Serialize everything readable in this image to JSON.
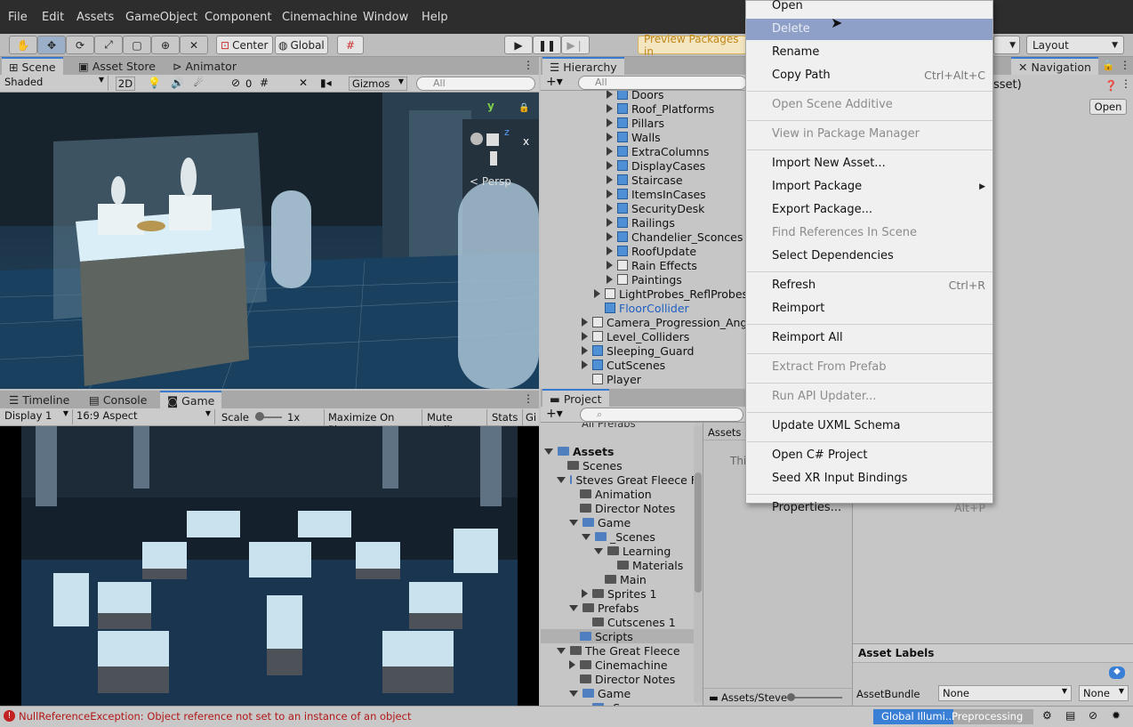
{
  "menubar": [
    "File",
    "Edit",
    "Assets",
    "GameObject",
    "Component",
    "Cinemachine",
    "Window",
    "Help"
  ],
  "toolbar": {
    "center": "Center",
    "global": "Global",
    "preview_packages": "Preview Packages in",
    "layout": "Layout"
  },
  "scene": {
    "tabs": [
      "Scene",
      "Asset Store",
      "Animator"
    ],
    "shaded": "Shaded",
    "mode_2d": "2D",
    "hidden_count": "0",
    "gizmos": "Gizmos",
    "search_placeholder": "All",
    "persp": "Persp",
    "axis_y": "y",
    "axis_x": "x",
    "axis_z": "z",
    "colors": {
      "sky": "#1f3444",
      "floor": "#1a3a57",
      "case": "#6f8ea1"
    }
  },
  "game": {
    "tabs": [
      "Timeline",
      "Console",
      "Game"
    ],
    "display": "Display 1",
    "aspect": "16:9 Aspect",
    "scale_label": "Scale",
    "scale_value": "1x",
    "maximize": "Maximize On Play",
    "mute": "Mute Audio",
    "stats": "Stats",
    "gizmos_short": "Gi"
  },
  "hierarchy": {
    "tab": "Hierarchy",
    "search_placeholder": "All",
    "items": [
      {
        "label": "Doors",
        "icon": "prefab-icon",
        "depth": 3
      },
      {
        "label": "Roof_Platforms",
        "icon": "prefab-icon",
        "depth": 3
      },
      {
        "label": "Pillars",
        "icon": "prefab-icon",
        "depth": 3
      },
      {
        "label": "Walls",
        "icon": "prefab-icon",
        "depth": 3
      },
      {
        "label": "ExtraColumns",
        "icon": "prefab-icon",
        "depth": 3
      },
      {
        "label": "DisplayCases",
        "icon": "prefab-icon",
        "depth": 3
      },
      {
        "label": "Staircase",
        "icon": "prefab-icon",
        "depth": 3
      },
      {
        "label": "ItemsInCases",
        "icon": "prefab-icon",
        "depth": 3
      },
      {
        "label": "SecurityDesk",
        "icon": "prefab-icon",
        "depth": 3
      },
      {
        "label": "Railings",
        "icon": "prefab-icon",
        "depth": 3
      },
      {
        "label": "Chandelier_Sconces",
        "icon": "prefab-icon",
        "depth": 3
      },
      {
        "label": "RoofUpdate",
        "icon": "prefab-icon",
        "depth": 3
      },
      {
        "label": "Rain Effects",
        "icon": "gameobject-icon",
        "depth": 3
      },
      {
        "label": "Paintings",
        "icon": "gameobject-icon",
        "depth": 3
      },
      {
        "label": "LightProbes_ReflProbes_C",
        "icon": "gameobject-icon",
        "depth": 2
      },
      {
        "label": "FloorCollider",
        "icon": "prefab-icon",
        "depth": 2
      },
      {
        "label": "Camera_Progression_Angles",
        "icon": "gameobject-icon",
        "depth": 1
      },
      {
        "label": "Level_Colliders",
        "icon": "gameobject-icon",
        "depth": 1
      },
      {
        "label": "Sleeping_Guard",
        "icon": "prefab-icon",
        "depth": 1
      },
      {
        "label": "CutScenes",
        "icon": "prefab-icon",
        "depth": 1
      },
      {
        "label": "Player",
        "icon": "gameobject-icon",
        "depth": 1
      }
    ]
  },
  "project": {
    "tab": "Project",
    "all_prefabs": "All Prefabs",
    "breadcrumb": "Assets",
    "right_text": "Thi",
    "path": "Assets/Steve",
    "tree": [
      {
        "label": "Assets",
        "depth": 0,
        "bold": true,
        "open": true
      },
      {
        "label": "Scenes",
        "depth": 1
      },
      {
        "label": "Steves Great Fleece F",
        "depth": 1,
        "open": true
      },
      {
        "label": "Animation",
        "depth": 2
      },
      {
        "label": "Director Notes",
        "depth": 2
      },
      {
        "label": "Game",
        "depth": 2,
        "open": true
      },
      {
        "label": "_Scenes",
        "depth": 3,
        "open": true
      },
      {
        "label": "Learning",
        "depth": 4,
        "open": true
      },
      {
        "label": "Materials",
        "depth": 5
      },
      {
        "label": "Main",
        "depth": 4
      },
      {
        "label": "Sprites 1",
        "depth": 3,
        "closed": true
      },
      {
        "label": "Prefabs",
        "depth": 2,
        "open": true
      },
      {
        "label": "Cutscenes 1",
        "depth": 3
      },
      {
        "label": "Scripts",
        "depth": 2,
        "selected": true
      },
      {
        "label": "The Great Fleece",
        "depth": 1,
        "open": true
      },
      {
        "label": "Cinemachine",
        "depth": 2,
        "closed": true
      },
      {
        "label": "Director Notes",
        "depth": 2
      },
      {
        "label": "Game",
        "depth": 2,
        "open": true
      },
      {
        "label": "_Scenes",
        "depth": 3
      }
    ]
  },
  "inspector": {
    "navigation_tab": "Navigation",
    "title_fragment": "sset)",
    "open_button": "Open",
    "asset_labels": "Asset Labels",
    "assetbundle_label": "AssetBundle",
    "assetbundle_value": "None",
    "variant_value": "None"
  },
  "context_menu": {
    "items": [
      {
        "label": "Open",
        "shortcut": "",
        "disabled": false
      },
      {
        "label": "Delete",
        "shortcut": "",
        "disabled": true,
        "hover": true
      },
      {
        "label": "Rename",
        "shortcut": "",
        "disabled": false
      },
      {
        "label": "Copy Path",
        "shortcut": "Ctrl+Alt+C",
        "disabled": false
      },
      {
        "sep": true
      },
      {
        "label": "Open Scene Additive",
        "shortcut": "",
        "disabled": true
      },
      {
        "sep": true
      },
      {
        "label": "View in Package Manager",
        "shortcut": "",
        "disabled": true
      },
      {
        "sep": true
      },
      {
        "label": "Import New Asset...",
        "shortcut": "",
        "disabled": false
      },
      {
        "label": "Import Package",
        "shortcut": "",
        "disabled": false,
        "submenu": true
      },
      {
        "label": "Export Package...",
        "shortcut": "",
        "disabled": false
      },
      {
        "label": "Find References In Scene",
        "shortcut": "",
        "disabled": true
      },
      {
        "label": "Select Dependencies",
        "shortcut": "",
        "disabled": false
      },
      {
        "sep": true
      },
      {
        "label": "Refresh",
        "shortcut": "Ctrl+R",
        "disabled": false
      },
      {
        "label": "Reimport",
        "shortcut": "",
        "disabled": false
      },
      {
        "sep": true
      },
      {
        "label": "Reimport All",
        "shortcut": "",
        "disabled": false
      },
      {
        "sep": true
      },
      {
        "label": "Extract From Prefab",
        "shortcut": "",
        "disabled": true
      },
      {
        "sep": true
      },
      {
        "label": "Run API Updater...",
        "shortcut": "",
        "disabled": true
      },
      {
        "sep": true
      },
      {
        "label": "Update UXML Schema",
        "shortcut": "",
        "disabled": false
      },
      {
        "sep": true
      },
      {
        "label": "Open C# Project",
        "shortcut": "",
        "disabled": false
      },
      {
        "label": "Seed XR Input Bindings",
        "shortcut": "",
        "disabled": false
      },
      {
        "sep": true
      },
      {
        "label": "Properties...",
        "shortcut": "Alt+P",
        "disabled": false
      }
    ]
  },
  "status": {
    "error": "NullReferenceException: Object reference not set to an instance of an object",
    "gi_label": "Global Illumi...",
    "gi_status": "Preprocessing"
  }
}
